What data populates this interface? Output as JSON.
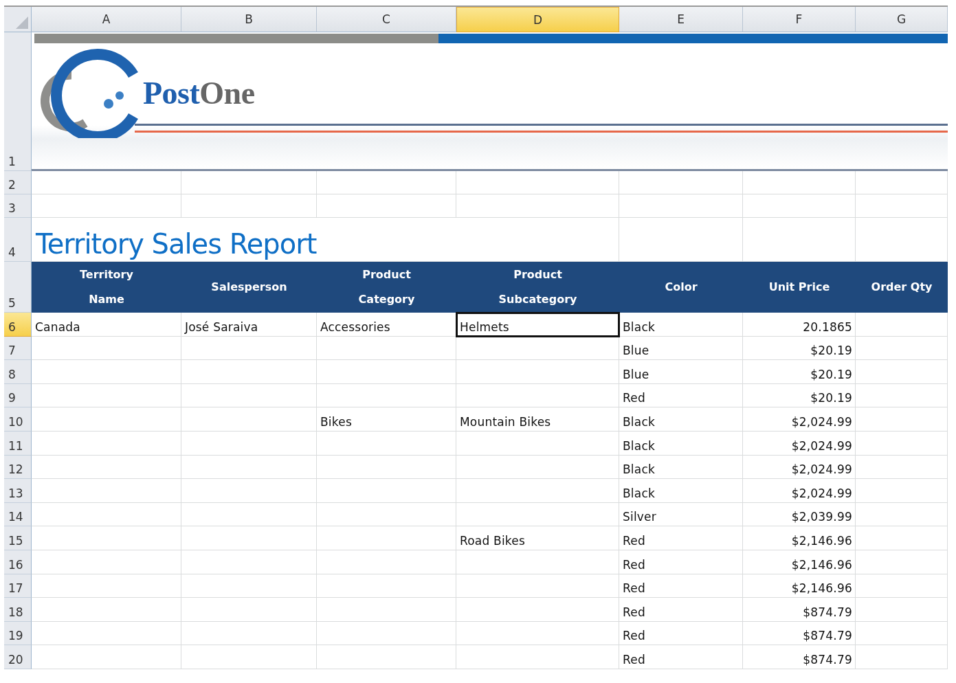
{
  "columns": [
    {
      "letter": "A",
      "selected": false
    },
    {
      "letter": "B",
      "selected": false
    },
    {
      "letter": "C",
      "selected": false
    },
    {
      "letter": "D",
      "selected": true
    },
    {
      "letter": "E",
      "selected": false
    },
    {
      "letter": "F",
      "selected": false
    },
    {
      "letter": "G",
      "selected": false
    }
  ],
  "banner": {
    "row": "1",
    "logo_first": "Post",
    "logo_second": "One"
  },
  "blank_rows": [
    "2",
    "3"
  ],
  "title_row": {
    "row": "4",
    "text": "Territory Sales Report"
  },
  "header_row": {
    "row": "5",
    "labels": [
      "Territory\nName",
      "Salesperson",
      "Product\nCategory",
      "Product\nSubcategory",
      "Color",
      "Unit Price",
      "Order Qty"
    ]
  },
  "rows": [
    {
      "row": "6",
      "selected": true,
      "territory": "Canada",
      "salesperson": "José Saraiva",
      "category": "Accessories",
      "subcategory": "Helmets",
      "color_name": "Black",
      "unit_price": "20.1865"
    },
    {
      "row": "7",
      "selected": false,
      "color_name": "Blue",
      "unit_price": "$20.19"
    },
    {
      "row": "8",
      "selected": false,
      "color_name": "Blue",
      "unit_price": "$20.19"
    },
    {
      "row": "9",
      "selected": false,
      "color_name": "Red",
      "unit_price": "$20.19"
    },
    {
      "row": "10",
      "selected": false,
      "category": "Bikes",
      "subcategory": "Mountain Bikes",
      "color_name": "Black",
      "unit_price": "$2,024.99"
    },
    {
      "row": "11",
      "selected": false,
      "color_name": "Black",
      "unit_price": "$2,024.99"
    },
    {
      "row": "12",
      "selected": false,
      "color_name": "Black",
      "unit_price": "$2,024.99"
    },
    {
      "row": "13",
      "selected": false,
      "color_name": "Black",
      "unit_price": "$2,024.99"
    },
    {
      "row": "14",
      "selected": false,
      "color_name": "Silver",
      "unit_price": "$2,039.99"
    },
    {
      "row": "15",
      "selected": false,
      "subcategory": "Road Bikes",
      "color_name": "Red",
      "unit_price": "$2,146.96"
    },
    {
      "row": "16",
      "selected": false,
      "color_name": "Red",
      "unit_price": "$2,146.96"
    },
    {
      "row": "17",
      "selected": false,
      "color_name": "Red",
      "unit_price": "$2,146.96"
    },
    {
      "row": "18",
      "selected": false,
      "color_name": "Red",
      "unit_price": "$874.79"
    },
    {
      "row": "19",
      "selected": false,
      "color_name": "Red",
      "unit_price": "$874.79"
    },
    {
      "row": "20",
      "selected": false,
      "color_name": "Red",
      "unit_price": "$874.79"
    }
  ]
}
